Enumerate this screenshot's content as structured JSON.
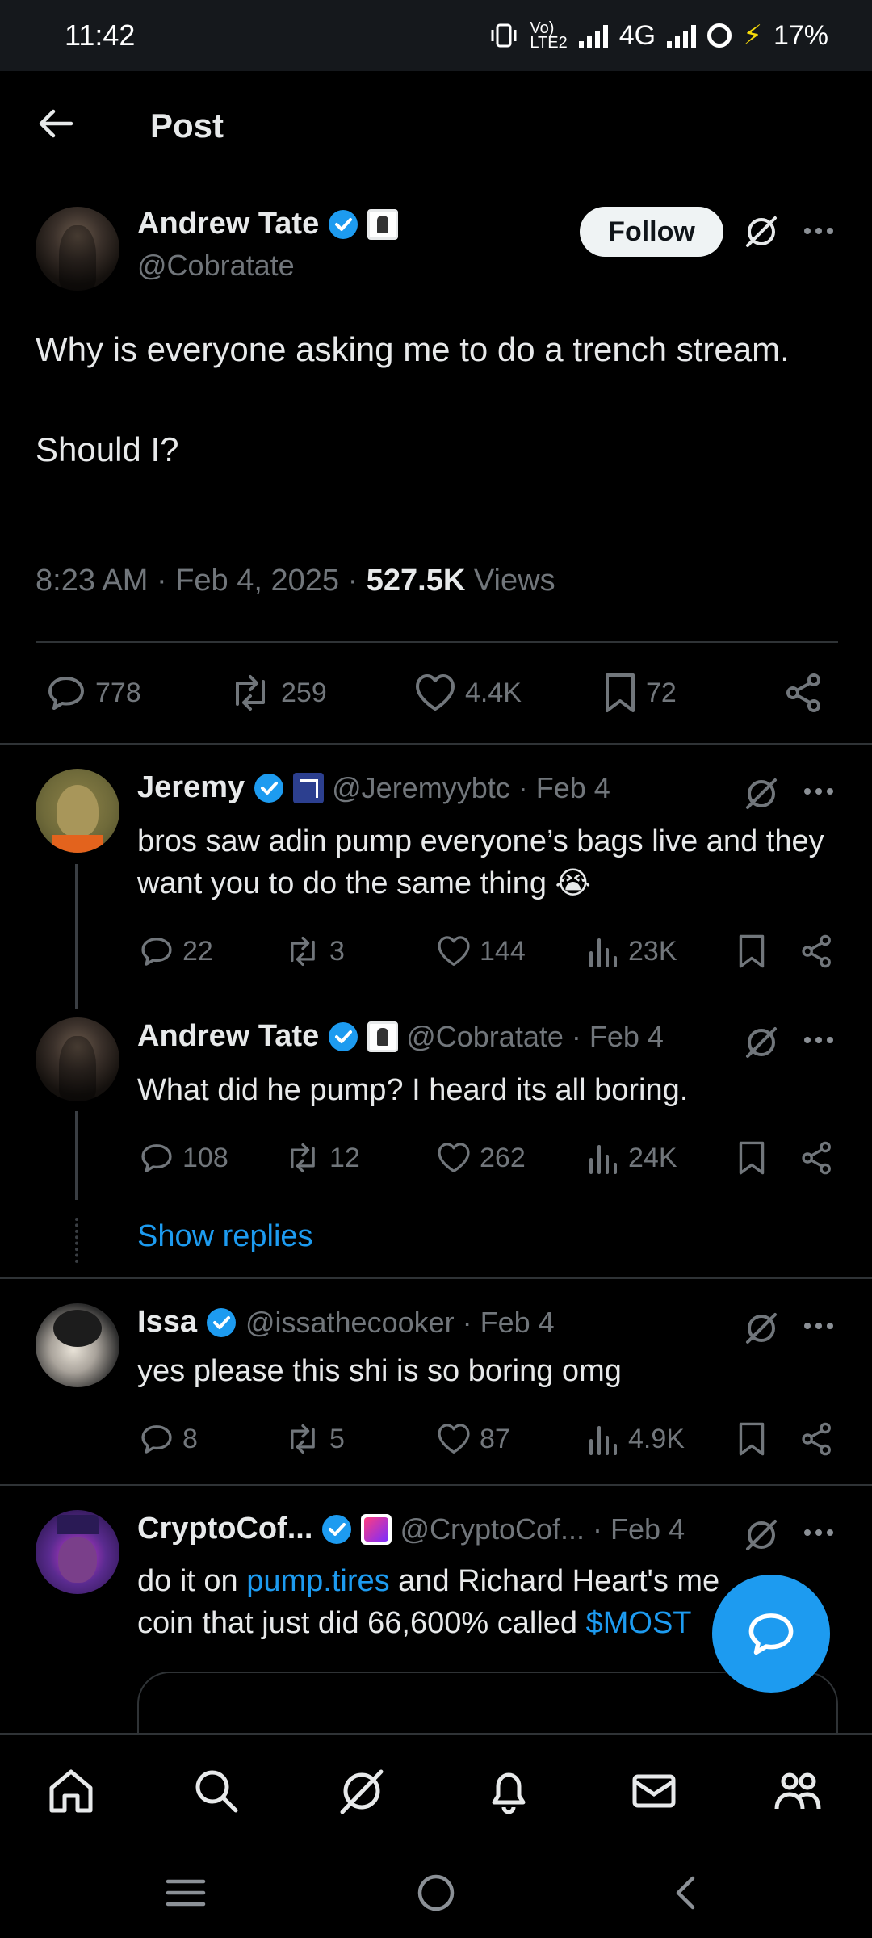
{
  "status_bar": {
    "time": "11:42",
    "net_label_top": "Vo)",
    "net_label_bottom": "LTE2",
    "network": "4G",
    "battery": "17%"
  },
  "header": {
    "title": "Post"
  },
  "main_post": {
    "author_name": "Andrew Tate",
    "author_handle": "@Cobratate",
    "follow_label": "Follow",
    "text": "Why is everyone asking me to do a trench stream.\n\nShould I?",
    "time_date": "8:23 AM · Feb 4, 2025 · ",
    "views_count": "527.5K",
    "views_label": " Views",
    "replies": "778",
    "reposts": "259",
    "likes": "4.4K",
    "bookmarks": "72"
  },
  "replies": [
    {
      "name": "Jeremy",
      "handle": "@Jeremyybtc · Feb 4",
      "text": "bros saw adin pump everyone’s bags live and they want you to do the same thing 😭",
      "replies": "22",
      "reposts": "3",
      "likes": "144",
      "views": "23K"
    },
    {
      "name": "Andrew Tate",
      "handle": "@Cobratate · Feb 4",
      "text": "What did he pump? I heard its all boring.",
      "replies": "108",
      "reposts": "12",
      "likes": "262",
      "views": "24K"
    },
    {
      "name": "Issa",
      "handle": "@issathecooker · Feb 4",
      "text": "yes please this shi is so boring omg",
      "replies": "8",
      "reposts": "5",
      "likes": "87",
      "views": "4.9K"
    },
    {
      "name": "CryptoCof...",
      "handle": "@CryptoCof... · Feb 4",
      "text_before": "do it on ",
      "link1": "pump.tires",
      "text_mid": " and Richard Heart's me",
      "text_line2": "coin that just did 66,600% called ",
      "link2": "$MOST"
    }
  ],
  "show_replies_label": "Show replies",
  "icons": {
    "back": "arrow-left-icon",
    "grok": "grok-icon",
    "more": "more-icon",
    "reply": "reply-icon",
    "repost": "repost-icon",
    "like": "heart-icon",
    "bookmark": "bookmark-icon",
    "share": "share-icon",
    "views": "views-icon",
    "home": "home-icon",
    "search": "search-icon",
    "notifications": "bell-icon",
    "messages": "mail-icon",
    "communities": "people-icon"
  },
  "colors": {
    "accent": "#1d9bf0",
    "background": "#000000",
    "muted": "#71767b"
  }
}
